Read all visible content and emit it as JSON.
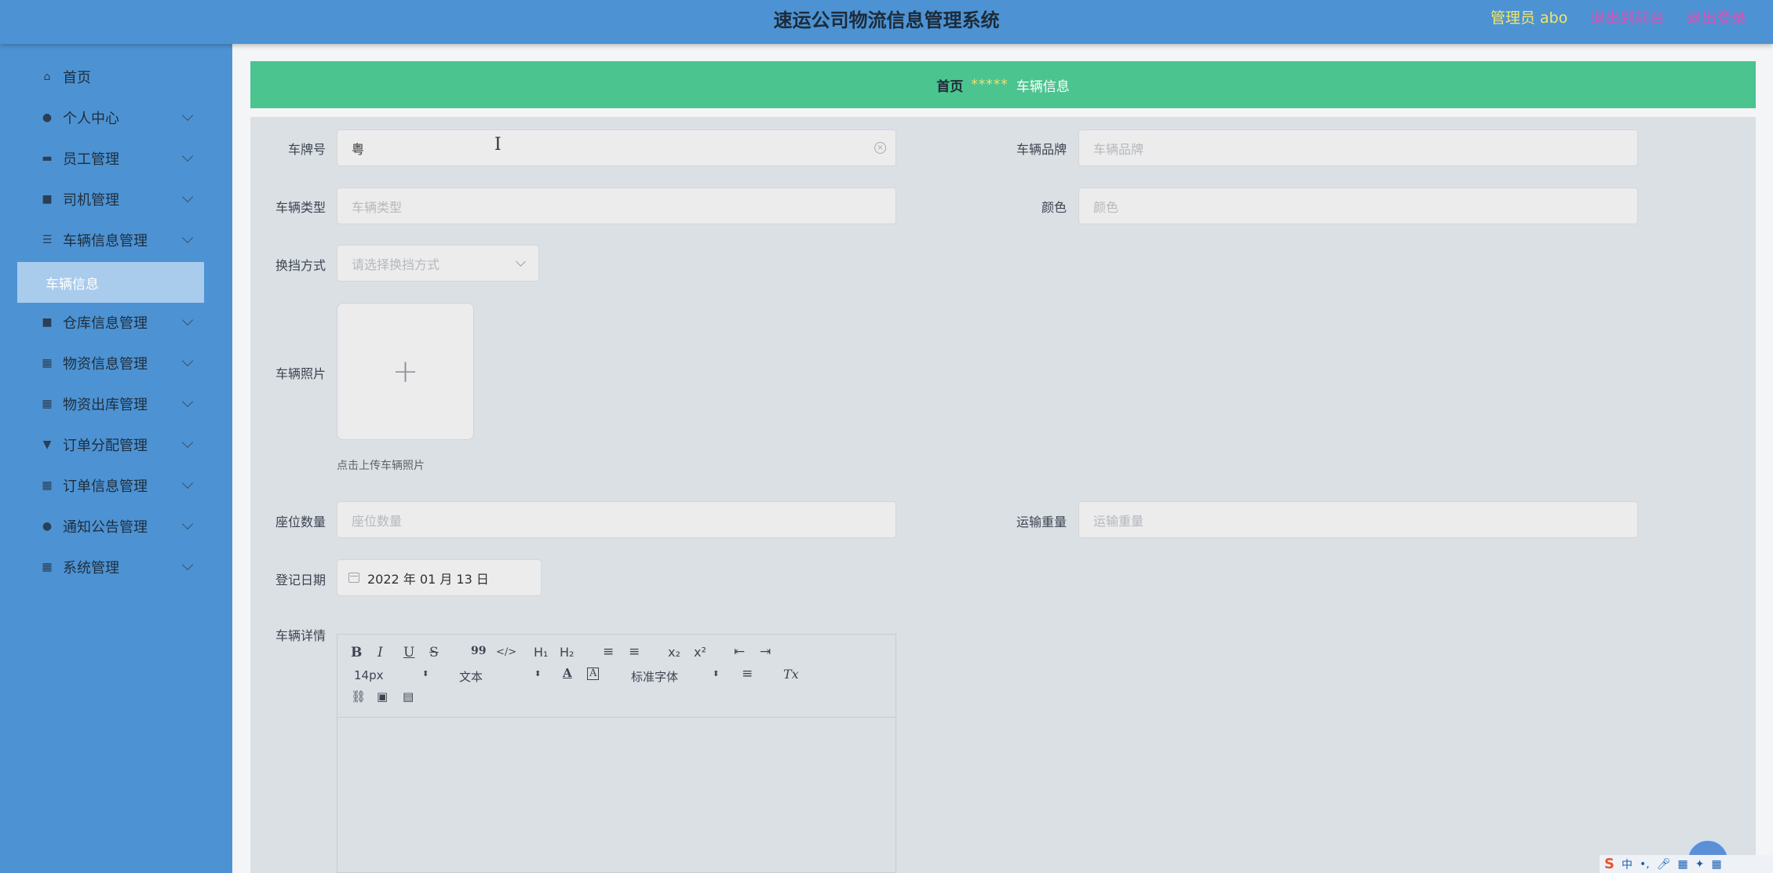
{
  "header": {
    "title": "速运公司物流信息管理系统",
    "user": "管理员 abo",
    "link_frontend": "退出到前台",
    "link_logout": "退出登录"
  },
  "sidebar": {
    "items": [
      {
        "label": "首页",
        "icon": "home-icon"
      },
      {
        "label": "个人中心",
        "icon": "user-icon"
      },
      {
        "label": "员工管理",
        "icon": "card-icon"
      },
      {
        "label": "司机管理",
        "icon": "briefcase-icon"
      },
      {
        "label": "车辆信息管理",
        "icon": "list-icon"
      },
      {
        "label": "车辆信息",
        "icon": ""
      },
      {
        "label": "仓库信息管理",
        "icon": "printer-icon"
      },
      {
        "label": "物资信息管理",
        "icon": "grid-icon"
      },
      {
        "label": "物资出库管理",
        "icon": "grid-icon"
      },
      {
        "label": "订单分配管理",
        "icon": "filter-icon"
      },
      {
        "label": "订单信息管理",
        "icon": "grid-icon"
      },
      {
        "label": "通知公告管理",
        "icon": "user-icon"
      },
      {
        "label": "系统管理",
        "icon": "grid-icon"
      }
    ]
  },
  "breadcrumb": {
    "home": "首页",
    "separator": "*****",
    "current": "车辆信息"
  },
  "form": {
    "plate": {
      "label": "车牌号",
      "value": "粤"
    },
    "brand": {
      "label": "车辆品牌",
      "placeholder": "车辆品牌"
    },
    "type": {
      "label": "车辆类型",
      "placeholder": "车辆类型"
    },
    "color": {
      "label": "颜色",
      "placeholder": "颜色"
    },
    "gear": {
      "label": "换挡方式",
      "placeholder": "请选择换挡方式"
    },
    "photo": {
      "label": "车辆照片",
      "tip": "点击上传车辆照片"
    },
    "seats": {
      "label": "座位数量",
      "placeholder": "座位数量"
    },
    "load": {
      "label": "运输重量",
      "placeholder": "运输重量"
    },
    "date": {
      "label": "登记日期",
      "value": "2022 年 01 月 13 日"
    },
    "detail": {
      "label": "车辆详情"
    }
  },
  "editor": {
    "bold": "B",
    "italic": "I",
    "underline": "U",
    "strike": "S",
    "quote": "99",
    "code": "</>",
    "h1": "H₁",
    "h2": "H₂",
    "ordered": "≡",
    "bullet": "≡",
    "sub": "x₂",
    "sup": "x²",
    "outdent": "⇤",
    "indent": "⇥",
    "size": "14px",
    "header": "文本",
    "font": "标准字体",
    "clear": "Tx"
  },
  "ime": {
    "logo": "S",
    "lang": "中"
  }
}
